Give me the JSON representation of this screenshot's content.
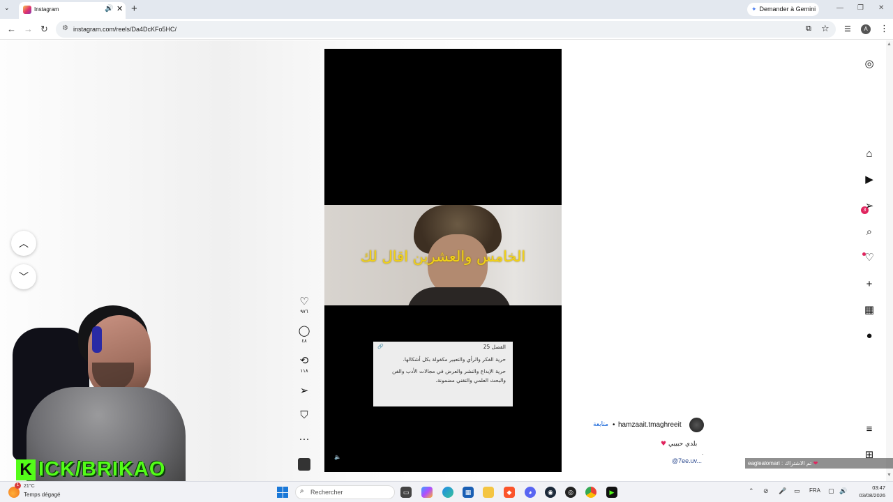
{
  "browser": {
    "tab": {
      "title": "Instagram"
    },
    "gemini_button": "Demander à Gemini",
    "url": "instagram.com/reels/Da4DcKFo5HC/",
    "profile_initial": "A"
  },
  "reel": {
    "subtitle": "الخامس والعشرين اقال لك",
    "card": {
      "heading": "الفصل 25",
      "paragraph_1": "حرية الفكر والرأي والتعبير مكفولة بكل أشكالها.",
      "paragraph_2": "حرية الإبداع والنشر والعرض في مجالات الأدب والفن والبحث العلمي والتقني مضمونة."
    }
  },
  "actions": {
    "likes": "٩٧٦",
    "comments": "٤٨",
    "reposts": "١١٨"
  },
  "post": {
    "username": "hamzaait.tmaghreeit",
    "separator": "•",
    "follow_label": "متابعة",
    "caption": "بلدي حبيبي",
    "caption_dot": ".",
    "mention": "@7ee.uv..."
  },
  "nav": {
    "messages_badge": "3"
  },
  "stream": {
    "kick_letter": "K",
    "kick_text": "ICK/BRIKAO",
    "alert_user": "eaglealomari",
    "alert_text": ": تم الاشتراك",
    "alert_heart": "❤"
  },
  "taskbar": {
    "weather_badge": "1",
    "temperature": "21°C",
    "weather": "Temps dégagé",
    "search_placeholder": "Rechercher",
    "language": "FRA",
    "time": "03:47",
    "date": "03/08/2026"
  },
  "colors": {
    "accent_pink": "#e0245e",
    "kick_green": "#53fc18",
    "subtitle_yellow": "#f2d216",
    "follow_blue": "#0b5ed7"
  }
}
